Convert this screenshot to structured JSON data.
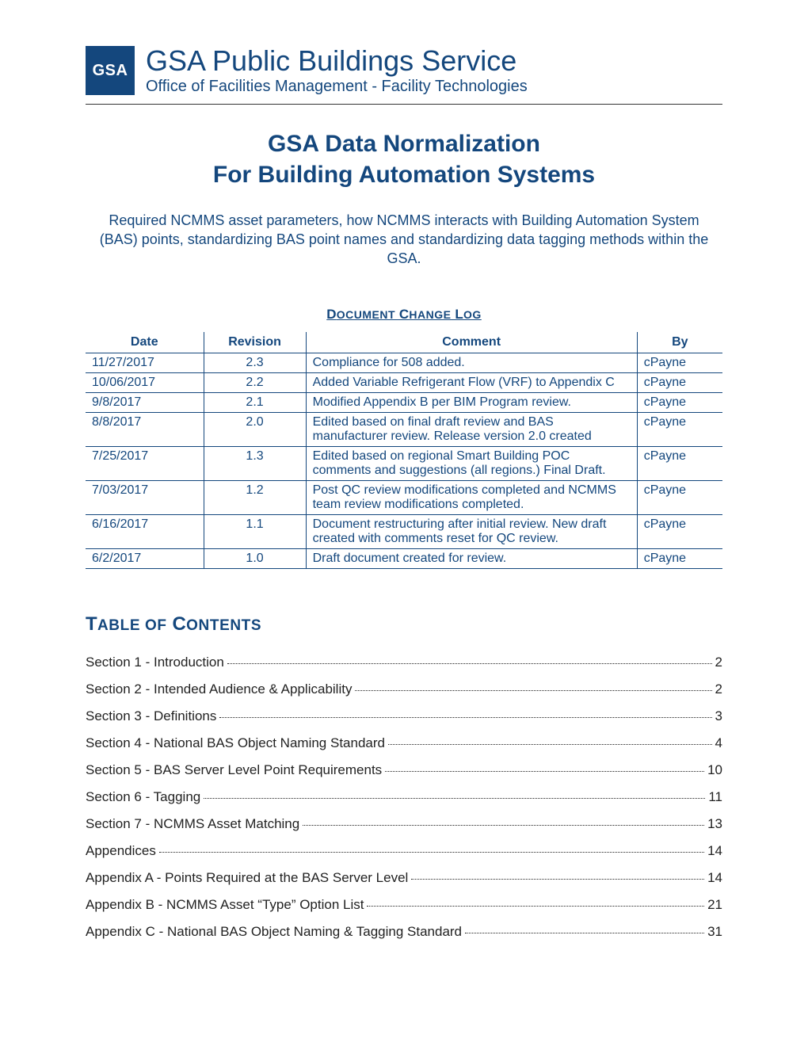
{
  "header": {
    "logo_text": "GSA",
    "title": "GSA Public Buildings Service",
    "subtitle": "Office of Facilities Management - Facility Technologies"
  },
  "main_title_line1": "GSA Data Normalization",
  "main_title_line2": "For Building Automation Systems",
  "summary": "Required NCMMS asset parameters, how NCMMS interacts with Building Automation System (BAS) points, standardizing BAS point names and standardizing data tagging methods within the GSA.",
  "changelog": {
    "title": "Document Change Log",
    "headers": {
      "date": "Date",
      "revision": "Revision",
      "comment": "Comment",
      "by": "By"
    },
    "rows": [
      {
        "date": "11/27/2017",
        "revision": "2.3",
        "comment": "Compliance for 508 added.",
        "by": "cPayne"
      },
      {
        "date": "10/06/2017",
        "revision": "2.2",
        "comment": "Added Variable Refrigerant Flow (VRF) to Appendix C",
        "by": "cPayne"
      },
      {
        "date": "9/8/2017",
        "revision": "2.1",
        "comment": "Modified Appendix B per BIM Program review.",
        "by": "cPayne"
      },
      {
        "date": "8/8/2017",
        "revision": "2.0",
        "comment": "Edited based on final draft review and BAS manufacturer review. Release version 2.0 created",
        "by": "cPayne"
      },
      {
        "date": "7/25/2017",
        "revision": "1.3",
        "comment": "Edited based on regional Smart Building POC comments and suggestions (all regions.) Final Draft.",
        "by": "cPayne"
      },
      {
        "date": "7/03/2017",
        "revision": "1.2",
        "comment": "Post QC review modifications completed and NCMMS team review modifications completed.",
        "by": "cPayne"
      },
      {
        "date": "6/16/2017",
        "revision": "1.1",
        "comment": "Document restructuring after initial review.\nNew draft created with comments reset for QC review.",
        "by": "cPayne"
      },
      {
        "date": "6/2/2017",
        "revision": "1.0",
        "comment": "Draft document created for review.",
        "by": "cPayne"
      }
    ]
  },
  "toc": {
    "heading": "Table of Contents",
    "items": [
      {
        "label": "Section 1 - Introduction",
        "page": "2"
      },
      {
        "label": "Section 2 - Intended Audience & Applicability",
        "page": "2"
      },
      {
        "label": "Section 3 - Definitions",
        "page": "3"
      },
      {
        "label": "Section 4 - National BAS Object Naming Standard",
        "page": "4"
      },
      {
        "label": "Section 5 - BAS Server Level Point Requirements",
        "page": "10"
      },
      {
        "label": "Section 6 - Tagging",
        "page": "11"
      },
      {
        "label": "Section 7 - NCMMS Asset Matching",
        "page": "13"
      },
      {
        "label": "Appendices",
        "page": "14"
      },
      {
        "label": "Appendix A - Points Required at the BAS Server Level",
        "page": "14"
      },
      {
        "label": "Appendix B - NCMMS Asset “Type” Option List",
        "page": "21"
      },
      {
        "label": "Appendix C - National BAS Object Naming & Tagging Standard",
        "page": "31"
      }
    ]
  }
}
